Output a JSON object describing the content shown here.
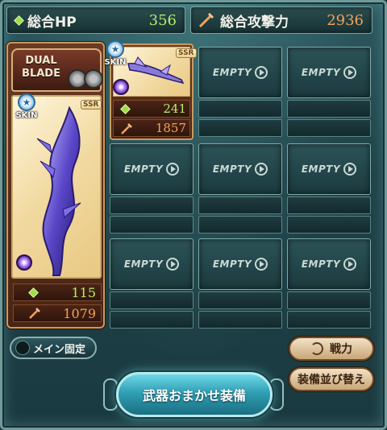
{
  "stats": {
    "hp_label": "総合HP",
    "hp_value": "356",
    "atk_label": "総合攻撃力",
    "atk_value": "2936"
  },
  "main_weapon": {
    "type_label": "DUAL BLADE",
    "skin_label": "SKIN",
    "rarity": "SSR",
    "hp": "115",
    "atk": "1079"
  },
  "sub_weapon_1": {
    "skin_label": "SKIN",
    "rarity": "SSR",
    "hp": "241",
    "atk": "1857"
  },
  "empty_label": "EMPTY",
  "buttons": {
    "main_lock": "メイン固定",
    "power": "戦力",
    "sort": "装備並び替え",
    "auto_equip": "武器おまかせ装備"
  },
  "colors": {
    "hp_green": "#b6ec6a",
    "atk_orange": "#f3a35c",
    "frame_teal": "#1e4248",
    "card_brown": "#4a2413"
  }
}
